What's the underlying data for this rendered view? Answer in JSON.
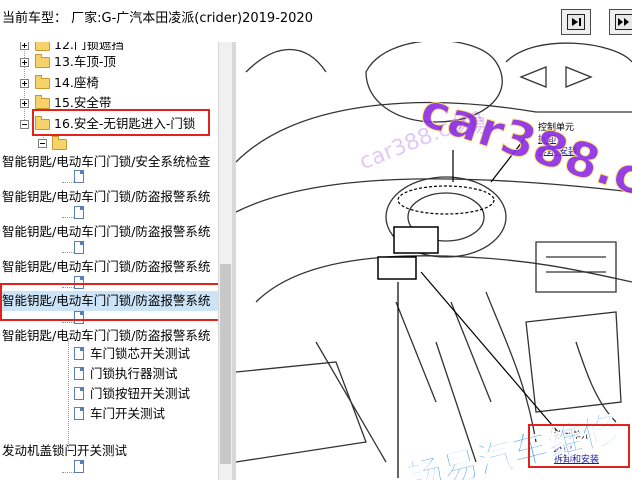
{
  "window": {
    "title": "当前车型：   厂家:G-广汽本田凌派(crider)2019-2020"
  },
  "nav": {
    "prev_icon": "prev-page-icon",
    "next_icon": "next-page-icon"
  },
  "tree": {
    "items": [
      {
        "label": "12.门锁遮挡",
        "kind": "folder"
      },
      {
        "label": "13.车顶-顶",
        "kind": "folder"
      },
      {
        "label": "14.座椅",
        "kind": "folder"
      },
      {
        "label": "15.安全带",
        "kind": "folder"
      },
      {
        "label": "16.安全-无钥匙进入-门锁",
        "kind": "folder",
        "highlighted": true
      },
      {
        "label": "智能钥匙/电动车门门锁/安全系统检查",
        "kind": "doc"
      },
      {
        "label": "智能钥匙/电动车门门锁/防盗报警系统",
        "kind": "doc"
      },
      {
        "label": "智能钥匙/电动车门门锁/防盗报警系统",
        "kind": "doc"
      },
      {
        "label": "智能钥匙/电动车门门锁/防盗报警系统",
        "kind": "doc"
      },
      {
        "label": "智能钥匙/电动车门门锁/防盗报警系统",
        "kind": "doc",
        "selected": true
      },
      {
        "label": "智能钥匙/电动车门门锁/防盗报警系统",
        "kind": "doc"
      },
      {
        "label": "车门锁芯开关测试",
        "kind": "doc"
      },
      {
        "label": "门锁执行器测试",
        "kind": "doc"
      },
      {
        "label": "门锁按钮开关测试",
        "kind": "doc"
      },
      {
        "label": "车门开关测试",
        "kind": "doc"
      },
      {
        "label": "发动机盖锁闩开关测试",
        "kind": "doc"
      }
    ]
  },
  "diagram": {
    "callout_top": {
      "line1": "控制单元",
      "line2": "拆卸",
      "line3": "拆卸/安装"
    },
    "callout_bottom": {
      "line1": "控制单元",
      "line2": "拆卸",
      "line3": "拆卸和安装"
    },
    "watermark_main": "car388.com",
    "watermark_cn": "畅易汽车维修",
    "watermark_small": "畅易",
    "watermark_domain": "car388.com"
  },
  "colors": {
    "highlight": "#e0241c",
    "selection": "#cce4f7",
    "link": "#1a1aa6",
    "watermark": "#8a2be2"
  }
}
